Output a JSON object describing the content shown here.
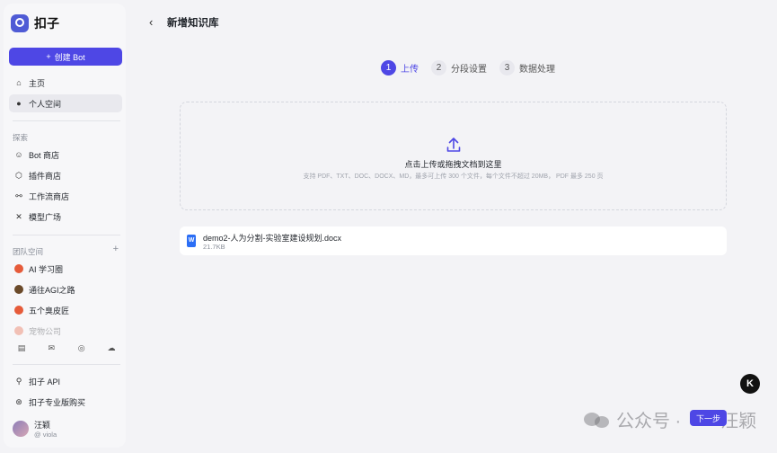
{
  "brand": {
    "name": "扣子"
  },
  "sidebar": {
    "create_label": "创建 Bot",
    "nav_top": [
      {
        "icon": "home-icon",
        "glyph": "⌂",
        "label": "主页"
      },
      {
        "icon": "person-icon",
        "glyph": "●",
        "label": "个人空间"
      }
    ],
    "explore_label": "探索",
    "explore": [
      {
        "icon": "bot-icon",
        "glyph": "☺",
        "label": "Bot 商店"
      },
      {
        "icon": "plugin-icon",
        "glyph": "⬡",
        "label": "插件商店"
      },
      {
        "icon": "workflow-icon",
        "glyph": "⚯",
        "label": "工作流商店"
      },
      {
        "icon": "model-icon",
        "glyph": "✕",
        "label": "模型广场"
      }
    ],
    "team_label": "团队空间",
    "teams": [
      {
        "label": "AI 学习圈"
      },
      {
        "label": "通往AGI之路"
      },
      {
        "label": "五个臭皮匠"
      },
      {
        "label": "宠物公司"
      }
    ],
    "bottom": [
      {
        "icon": "api-icon",
        "glyph": "⚲",
        "label": "扣子 API"
      },
      {
        "icon": "pro-icon",
        "glyph": "⊛",
        "label": "扣子专业版购买"
      }
    ],
    "user": {
      "name": "汪颖",
      "handle": "@ viola"
    }
  },
  "header": {
    "title": "新增知识库"
  },
  "steps": [
    {
      "num": "1",
      "label": "上传"
    },
    {
      "num": "2",
      "label": "分段设置"
    },
    {
      "num": "3",
      "label": "数据处理"
    }
  ],
  "dropzone": {
    "title": "点击上传或拖拽文档到这里",
    "hint": "支持 PDF、TXT、DOC、DOCX、MD，最多可上传 300 个文件，每个文件不超过 20MB， PDF 最多 250 页"
  },
  "file": {
    "name": "demo2-人为分割-实验室建设规划.docx",
    "size": "21.7KB"
  },
  "floating": {
    "badge": "K"
  },
  "footer": {
    "next_label": "下一步"
  },
  "watermark": {
    "text1": "公众号 ·",
    "text2": "汪颖"
  },
  "colors": {
    "accent": "#4e47e5",
    "background": "#f3f3f6"
  }
}
